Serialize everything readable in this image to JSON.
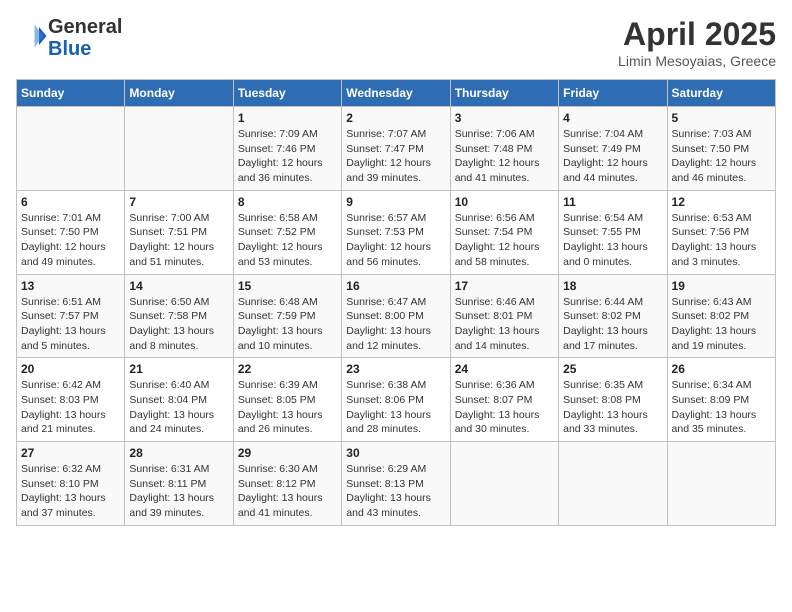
{
  "header": {
    "logo_line1": "General",
    "logo_line2": "Blue",
    "title": "April 2025",
    "location": "Limin Mesoyaias, Greece"
  },
  "columns": [
    "Sunday",
    "Monday",
    "Tuesday",
    "Wednesday",
    "Thursday",
    "Friday",
    "Saturday"
  ],
  "weeks": [
    [
      {
        "day": "",
        "info": ""
      },
      {
        "day": "",
        "info": ""
      },
      {
        "day": "1",
        "info": "Sunrise: 7:09 AM\nSunset: 7:46 PM\nDaylight: 12 hours\nand 36 minutes."
      },
      {
        "day": "2",
        "info": "Sunrise: 7:07 AM\nSunset: 7:47 PM\nDaylight: 12 hours\nand 39 minutes."
      },
      {
        "day": "3",
        "info": "Sunrise: 7:06 AM\nSunset: 7:48 PM\nDaylight: 12 hours\nand 41 minutes."
      },
      {
        "day": "4",
        "info": "Sunrise: 7:04 AM\nSunset: 7:49 PM\nDaylight: 12 hours\nand 44 minutes."
      },
      {
        "day": "5",
        "info": "Sunrise: 7:03 AM\nSunset: 7:50 PM\nDaylight: 12 hours\nand 46 minutes."
      }
    ],
    [
      {
        "day": "6",
        "info": "Sunrise: 7:01 AM\nSunset: 7:50 PM\nDaylight: 12 hours\nand 49 minutes."
      },
      {
        "day": "7",
        "info": "Sunrise: 7:00 AM\nSunset: 7:51 PM\nDaylight: 12 hours\nand 51 minutes."
      },
      {
        "day": "8",
        "info": "Sunrise: 6:58 AM\nSunset: 7:52 PM\nDaylight: 12 hours\nand 53 minutes."
      },
      {
        "day": "9",
        "info": "Sunrise: 6:57 AM\nSunset: 7:53 PM\nDaylight: 12 hours\nand 56 minutes."
      },
      {
        "day": "10",
        "info": "Sunrise: 6:56 AM\nSunset: 7:54 PM\nDaylight: 12 hours\nand 58 minutes."
      },
      {
        "day": "11",
        "info": "Sunrise: 6:54 AM\nSunset: 7:55 PM\nDaylight: 13 hours\nand 0 minutes."
      },
      {
        "day": "12",
        "info": "Sunrise: 6:53 AM\nSunset: 7:56 PM\nDaylight: 13 hours\nand 3 minutes."
      }
    ],
    [
      {
        "day": "13",
        "info": "Sunrise: 6:51 AM\nSunset: 7:57 PM\nDaylight: 13 hours\nand 5 minutes."
      },
      {
        "day": "14",
        "info": "Sunrise: 6:50 AM\nSunset: 7:58 PM\nDaylight: 13 hours\nand 8 minutes."
      },
      {
        "day": "15",
        "info": "Sunrise: 6:48 AM\nSunset: 7:59 PM\nDaylight: 13 hours\nand 10 minutes."
      },
      {
        "day": "16",
        "info": "Sunrise: 6:47 AM\nSunset: 8:00 PM\nDaylight: 13 hours\nand 12 minutes."
      },
      {
        "day": "17",
        "info": "Sunrise: 6:46 AM\nSunset: 8:01 PM\nDaylight: 13 hours\nand 14 minutes."
      },
      {
        "day": "18",
        "info": "Sunrise: 6:44 AM\nSunset: 8:02 PM\nDaylight: 13 hours\nand 17 minutes."
      },
      {
        "day": "19",
        "info": "Sunrise: 6:43 AM\nSunset: 8:02 PM\nDaylight: 13 hours\nand 19 minutes."
      }
    ],
    [
      {
        "day": "20",
        "info": "Sunrise: 6:42 AM\nSunset: 8:03 PM\nDaylight: 13 hours\nand 21 minutes."
      },
      {
        "day": "21",
        "info": "Sunrise: 6:40 AM\nSunset: 8:04 PM\nDaylight: 13 hours\nand 24 minutes."
      },
      {
        "day": "22",
        "info": "Sunrise: 6:39 AM\nSunset: 8:05 PM\nDaylight: 13 hours\nand 26 minutes."
      },
      {
        "day": "23",
        "info": "Sunrise: 6:38 AM\nSunset: 8:06 PM\nDaylight: 13 hours\nand 28 minutes."
      },
      {
        "day": "24",
        "info": "Sunrise: 6:36 AM\nSunset: 8:07 PM\nDaylight: 13 hours\nand 30 minutes."
      },
      {
        "day": "25",
        "info": "Sunrise: 6:35 AM\nSunset: 8:08 PM\nDaylight: 13 hours\nand 33 minutes."
      },
      {
        "day": "26",
        "info": "Sunrise: 6:34 AM\nSunset: 8:09 PM\nDaylight: 13 hours\nand 35 minutes."
      }
    ],
    [
      {
        "day": "27",
        "info": "Sunrise: 6:32 AM\nSunset: 8:10 PM\nDaylight: 13 hours\nand 37 minutes."
      },
      {
        "day": "28",
        "info": "Sunrise: 6:31 AM\nSunset: 8:11 PM\nDaylight: 13 hours\nand 39 minutes."
      },
      {
        "day": "29",
        "info": "Sunrise: 6:30 AM\nSunset: 8:12 PM\nDaylight: 13 hours\nand 41 minutes."
      },
      {
        "day": "30",
        "info": "Sunrise: 6:29 AM\nSunset: 8:13 PM\nDaylight: 13 hours\nand 43 minutes."
      },
      {
        "day": "",
        "info": ""
      },
      {
        "day": "",
        "info": ""
      },
      {
        "day": "",
        "info": ""
      }
    ]
  ]
}
